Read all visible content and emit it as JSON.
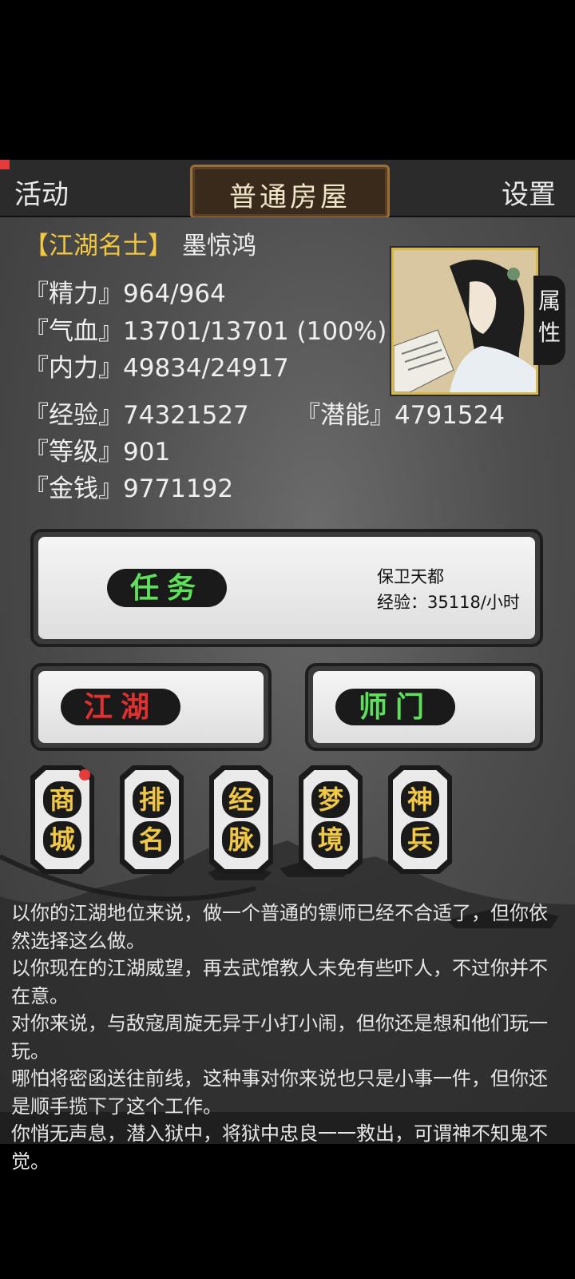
{
  "header": {
    "activity_label": "活动",
    "location_title": "普通房屋",
    "settings_label": "设置"
  },
  "character": {
    "rank": "【江湖名士】",
    "name": "墨惊鸿",
    "stats": {
      "energy": "『精力』964/964",
      "health": "『气血』13701/13701 (100%)",
      "internal": "『内力』49834/24917",
      "experience": "『经验』74321527",
      "potential": "『潜能』4791524",
      "level": "『等级』901",
      "money": "『金钱』9771192"
    },
    "attributes_tab": [
      "属",
      "性"
    ]
  },
  "task": {
    "button_label": "任务",
    "name": "保卫天都",
    "exp_rate": "经验：35118/小时"
  },
  "buttons": {
    "jianghu": "江湖",
    "shimen": "师门"
  },
  "tiles": [
    {
      "top": "商",
      "bottom": "城"
    },
    {
      "top": "排",
      "bottom": "名"
    },
    {
      "top": "经",
      "bottom": "脉"
    },
    {
      "top": "梦",
      "bottom": "境"
    },
    {
      "top": "神",
      "bottom": "兵"
    }
  ],
  "story_log": [
    "以你的江湖地位来说，做一个普通的镖师已经不合适了，但你依然选择这么做。",
    "以你现在的江湖威望，再去武馆教人未免有些吓人，不过你并不在意。",
    "对你来说，与敌寇周旋无异于小打小闹，但你还是想和他们玩一玩。",
    "哪怕将密函送往前线，这种事对你来说也只是小事一件，但你还是顺手揽下了这个工作。",
    "你悄无声息，潜入狱中，将狱中忠良一一救出，可谓神不知鬼不觉。"
  ]
}
